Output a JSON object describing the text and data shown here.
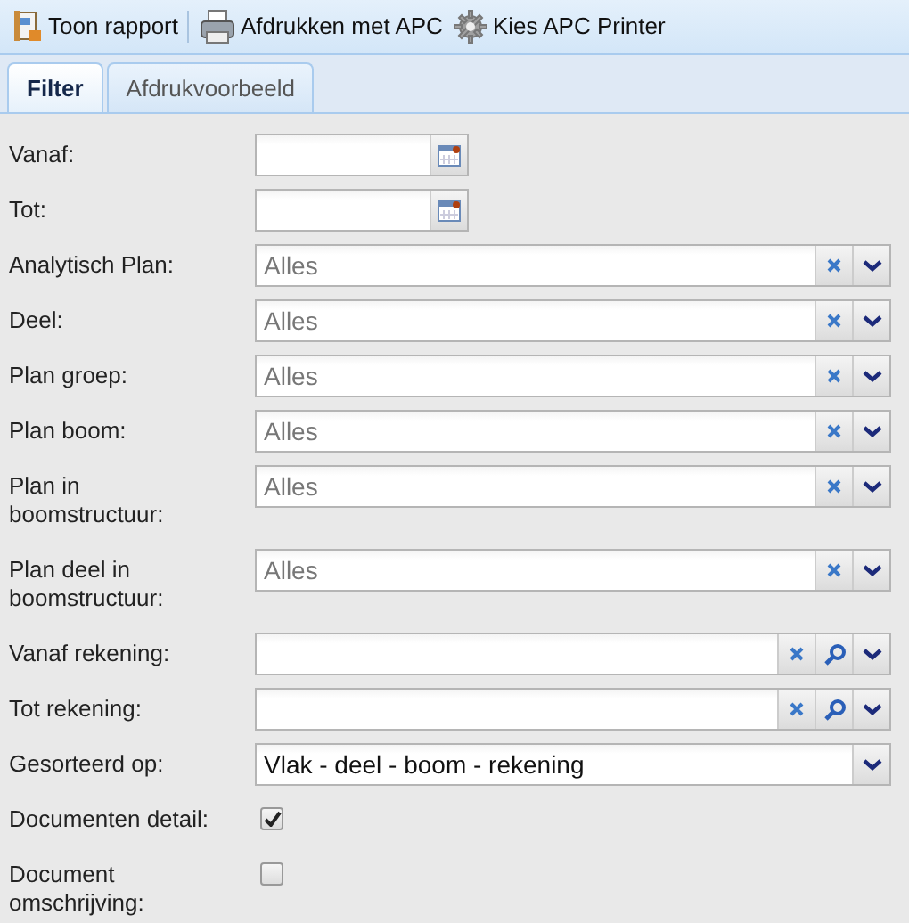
{
  "toolbar": [
    {
      "label": "Toon rapport"
    },
    {
      "label": "Afdrukken met APC"
    },
    {
      "label": "Kies APC Printer"
    }
  ],
  "tabs": [
    {
      "label": "Filter",
      "selected": true
    },
    {
      "label": "Afdrukvoorbeeld",
      "selected": false
    }
  ],
  "fields": [
    {
      "kind": "date",
      "label": "Vanaf:"
    },
    {
      "kind": "date",
      "label": "Tot:"
    },
    {
      "kind": "combo",
      "label": "Analytisch Plan:",
      "placeholder": "Alles"
    },
    {
      "kind": "combo",
      "label": "Deel:",
      "placeholder": "Alles"
    },
    {
      "kind": "combo",
      "label": "Plan groep:",
      "placeholder": "Alles"
    },
    {
      "kind": "combo",
      "label": "Plan boom:",
      "placeholder": "Alles"
    },
    {
      "kind": "combo",
      "label": "Plan in boomstructuur:",
      "placeholder": "Alles"
    },
    {
      "kind": "combo",
      "label": "Plan deel in boomstructuur:",
      "placeholder": "Alles"
    },
    {
      "kind": "lookup",
      "label": "Vanaf rekening:"
    },
    {
      "kind": "lookup",
      "label": "Tot rekening:"
    },
    {
      "kind": "select",
      "label": "Gesorteerd op:",
      "value": "Vlak - deel - boom - rekening"
    },
    {
      "kind": "checkbox",
      "label": "Documenten detail:",
      "checked": true
    },
    {
      "kind": "checkbox",
      "label": "Document omschrijving:",
      "checked": false
    }
  ]
}
